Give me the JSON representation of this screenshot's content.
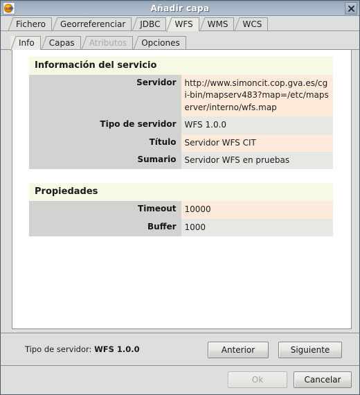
{
  "window": {
    "title": "Añadir capa",
    "icon": "sig-logo-icon",
    "close_label": "×"
  },
  "outer_tabs": [
    {
      "label": "Fichero",
      "selected": false,
      "disabled": false
    },
    {
      "label": "Georreferenciar",
      "selected": false,
      "disabled": false
    },
    {
      "label": "JDBC",
      "selected": false,
      "disabled": false
    },
    {
      "label": "WFS",
      "selected": true,
      "disabled": false
    },
    {
      "label": "WMS",
      "selected": false,
      "disabled": false
    },
    {
      "label": "WCS",
      "selected": false,
      "disabled": false
    }
  ],
  "inner_tabs": [
    {
      "label": "Info",
      "selected": true,
      "disabled": false
    },
    {
      "label": "Capas",
      "selected": false,
      "disabled": false
    },
    {
      "label": "Atributos",
      "selected": false,
      "disabled": true
    },
    {
      "label": "Opciones",
      "selected": false,
      "disabled": false
    }
  ],
  "service_info": {
    "section_title": "Información del servicio",
    "rows": [
      {
        "key": "Servidor",
        "value": "http://www.simoncit.cop.gva.es/cgi-bin/mapserv483?map=/etc/mapserver/interno/wfs.map"
      },
      {
        "key": "Tipo de servidor",
        "value": "WFS 1.0.0"
      },
      {
        "key": "Título",
        "value": "Servidor WFS CIT"
      },
      {
        "key": "Sumario",
        "value": "Servidor WFS en pruebas"
      }
    ]
  },
  "properties": {
    "section_title": "Propiedades",
    "rows": [
      {
        "key": "Timeout",
        "value": "10000"
      },
      {
        "key": "Buffer",
        "value": "1000"
      }
    ]
  },
  "status": {
    "label": "Tipo de servidor:",
    "value": "WFS 1.0.0"
  },
  "wizard_buttons": {
    "previous": "Anterior",
    "next": "Siguiente"
  },
  "dialog_buttons": {
    "ok": "Ok",
    "cancel": "Cancelar"
  },
  "colors": {
    "titlebar_start": "#8e9fb2",
    "titlebar_end": "#b6c2cf",
    "section_header_bg": "#f8f9e4",
    "key_cell_bg": "#d2d2d0",
    "row_odd_bg": "#fdeada",
    "row_even_bg": "#e7e8e4",
    "window_bg": "#dedede",
    "panel_bg": "#ffffff"
  }
}
